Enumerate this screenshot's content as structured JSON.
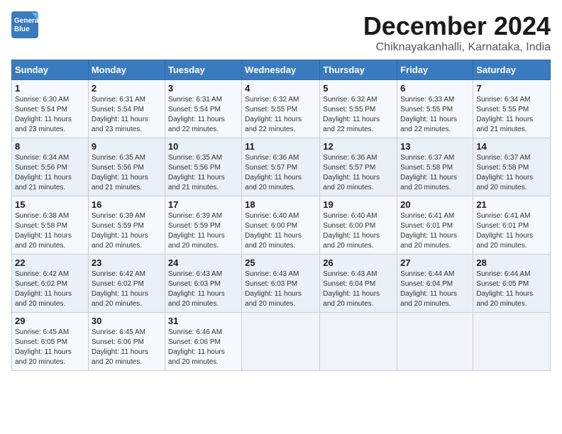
{
  "logo": {
    "line1": "General",
    "line2": "Blue",
    "tagline": "Blue"
  },
  "title": "December 2024",
  "subtitle": "Chiknayakanhalli, Karnataka, India",
  "days_of_week": [
    "Sunday",
    "Monday",
    "Tuesday",
    "Wednesday",
    "Thursday",
    "Friday",
    "Saturday"
  ],
  "weeks": [
    [
      {
        "day": "1",
        "info": "Sunrise: 6:30 AM\nSunset: 5:54 PM\nDaylight: 11 hours\nand 23 minutes."
      },
      {
        "day": "2",
        "info": "Sunrise: 6:31 AM\nSunset: 5:54 PM\nDaylight: 11 hours\nand 23 minutes."
      },
      {
        "day": "3",
        "info": "Sunrise: 6:31 AM\nSunset: 5:54 PM\nDaylight: 11 hours\nand 22 minutes."
      },
      {
        "day": "4",
        "info": "Sunrise: 6:32 AM\nSunset: 5:55 PM\nDaylight: 11 hours\nand 22 minutes."
      },
      {
        "day": "5",
        "info": "Sunrise: 6:32 AM\nSunset: 5:55 PM\nDaylight: 11 hours\nand 22 minutes."
      },
      {
        "day": "6",
        "info": "Sunrise: 6:33 AM\nSunset: 5:55 PM\nDaylight: 11 hours\nand 22 minutes."
      },
      {
        "day": "7",
        "info": "Sunrise: 6:34 AM\nSunset: 5:55 PM\nDaylight: 11 hours\nand 21 minutes."
      }
    ],
    [
      {
        "day": "8",
        "info": "Sunrise: 6:34 AM\nSunset: 5:56 PM\nDaylight: 11 hours\nand 21 minutes."
      },
      {
        "day": "9",
        "info": "Sunrise: 6:35 AM\nSunset: 5:56 PM\nDaylight: 11 hours\nand 21 minutes."
      },
      {
        "day": "10",
        "info": "Sunrise: 6:35 AM\nSunset: 5:56 PM\nDaylight: 11 hours\nand 21 minutes."
      },
      {
        "day": "11",
        "info": "Sunrise: 6:36 AM\nSunset: 5:57 PM\nDaylight: 11 hours\nand 20 minutes."
      },
      {
        "day": "12",
        "info": "Sunrise: 6:36 AM\nSunset: 5:57 PM\nDaylight: 11 hours\nand 20 minutes."
      },
      {
        "day": "13",
        "info": "Sunrise: 6:37 AM\nSunset: 5:58 PM\nDaylight: 11 hours\nand 20 minutes."
      },
      {
        "day": "14",
        "info": "Sunrise: 6:37 AM\nSunset: 5:58 PM\nDaylight: 11 hours\nand 20 minutes."
      }
    ],
    [
      {
        "day": "15",
        "info": "Sunrise: 6:38 AM\nSunset: 5:58 PM\nDaylight: 11 hours\nand 20 minutes."
      },
      {
        "day": "16",
        "info": "Sunrise: 6:39 AM\nSunset: 5:59 PM\nDaylight: 11 hours\nand 20 minutes."
      },
      {
        "day": "17",
        "info": "Sunrise: 6:39 AM\nSunset: 5:59 PM\nDaylight: 11 hours\nand 20 minutes."
      },
      {
        "day": "18",
        "info": "Sunrise: 6:40 AM\nSunset: 6:00 PM\nDaylight: 11 hours\nand 20 minutes."
      },
      {
        "day": "19",
        "info": "Sunrise: 6:40 AM\nSunset: 6:00 PM\nDaylight: 11 hours\nand 20 minutes."
      },
      {
        "day": "20",
        "info": "Sunrise: 6:41 AM\nSunset: 6:01 PM\nDaylight: 11 hours\nand 20 minutes."
      },
      {
        "day": "21",
        "info": "Sunrise: 6:41 AM\nSunset: 6:01 PM\nDaylight: 11 hours\nand 20 minutes."
      }
    ],
    [
      {
        "day": "22",
        "info": "Sunrise: 6:42 AM\nSunset: 6:02 PM\nDaylight: 11 hours\nand 20 minutes."
      },
      {
        "day": "23",
        "info": "Sunrise: 6:42 AM\nSunset: 6:02 PM\nDaylight: 11 hours\nand 20 minutes."
      },
      {
        "day": "24",
        "info": "Sunrise: 6:43 AM\nSunset: 6:03 PM\nDaylight: 11 hours\nand 20 minutes."
      },
      {
        "day": "25",
        "info": "Sunrise: 6:43 AM\nSunset: 6:03 PM\nDaylight: 11 hours\nand 20 minutes."
      },
      {
        "day": "26",
        "info": "Sunrise: 6:43 AM\nSunset: 6:04 PM\nDaylight: 11 hours\nand 20 minutes."
      },
      {
        "day": "27",
        "info": "Sunrise: 6:44 AM\nSunset: 6:04 PM\nDaylight: 11 hours\nand 20 minutes."
      },
      {
        "day": "28",
        "info": "Sunrise: 6:44 AM\nSunset: 6:05 PM\nDaylight: 11 hours\nand 20 minutes."
      }
    ],
    [
      {
        "day": "29",
        "info": "Sunrise: 6:45 AM\nSunset: 6:05 PM\nDaylight: 11 hours\nand 20 minutes."
      },
      {
        "day": "30",
        "info": "Sunrise: 6:45 AM\nSunset: 6:06 PM\nDaylight: 11 hours\nand 20 minutes."
      },
      {
        "day": "31",
        "info": "Sunrise: 6:46 AM\nSunset: 6:06 PM\nDaylight: 11 hours\nand 20 minutes."
      },
      {
        "day": "",
        "info": ""
      },
      {
        "day": "",
        "info": ""
      },
      {
        "day": "",
        "info": ""
      },
      {
        "day": "",
        "info": ""
      }
    ]
  ]
}
